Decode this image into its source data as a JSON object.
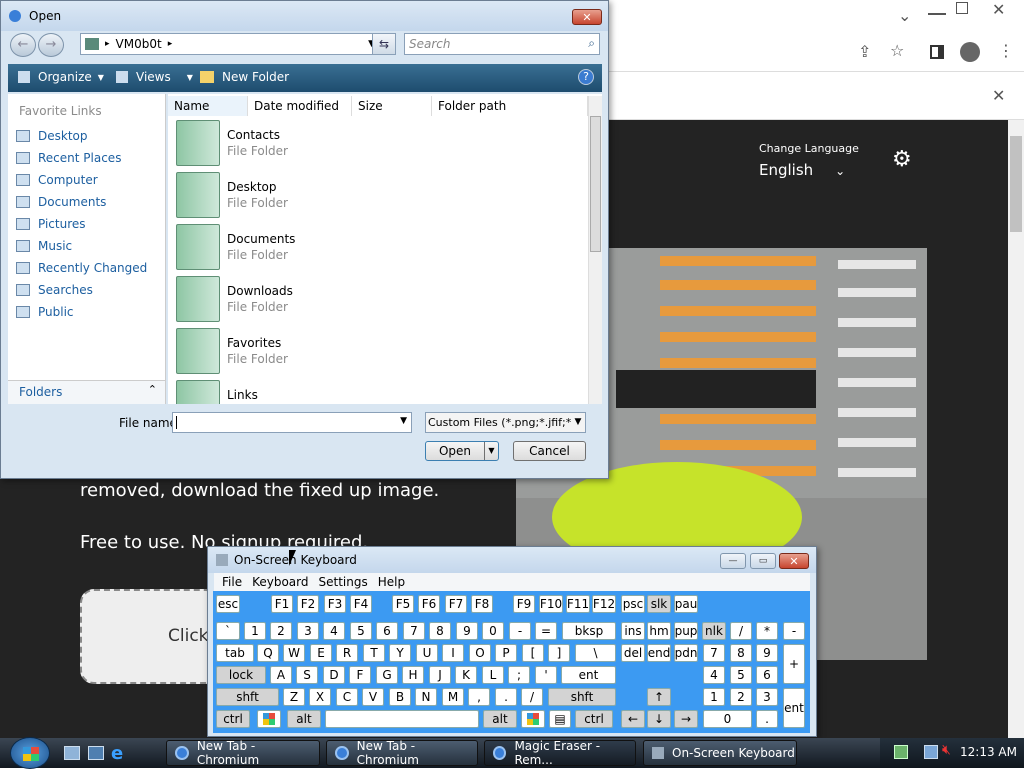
{
  "browser": {
    "change_language_label": "Change Language",
    "language_value": "English",
    "page_text_1": "removed, download the fixed up image.",
    "page_text_2": "Free to use. No signup required.",
    "upload_button_partial": "Click"
  },
  "open_dialog": {
    "title": "Open",
    "address_path": "VM0b0t",
    "search_placeholder": "Search",
    "toolbar": {
      "organize": "Organize",
      "views": "Views",
      "new_folder": "New Folder"
    },
    "favorite_links_header": "Favorite Links",
    "nav_items": [
      "Desktop",
      "Recent Places",
      "Computer",
      "Documents",
      "Pictures",
      "Music",
      "Recently Changed",
      "Searches",
      "Public"
    ],
    "folders_label": "Folders",
    "columns": [
      "Name",
      "Date modified",
      "Size",
      "Folder path"
    ],
    "files": [
      {
        "name": "Contacts",
        "type": "File Folder"
      },
      {
        "name": "Desktop",
        "type": "File Folder"
      },
      {
        "name": "Documents",
        "type": "File Folder"
      },
      {
        "name": "Downloads",
        "type": "File Folder"
      },
      {
        "name": "Favorites",
        "type": "File Folder"
      },
      {
        "name": "Links",
        "type": ""
      }
    ],
    "file_name_label": "File name:",
    "file_name_value": "",
    "filter_value": "Custom Files (*.png;*.jfif;*.pjpe",
    "open_button": "Open",
    "cancel_button": "Cancel"
  },
  "osk": {
    "title": "On-Screen Keyboard",
    "menu": [
      "File",
      "Keyboard",
      "Settings",
      "Help"
    ]
  },
  "taskbar": {
    "tasks": [
      "New Tab - Chromium",
      "New Tab - Chromium",
      "Magic Eraser - Rem...",
      "On-Screen Keyboard"
    ],
    "clock": "12:13 AM"
  }
}
